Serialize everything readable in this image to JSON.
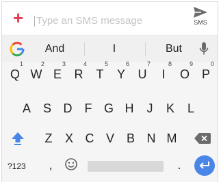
{
  "compose": {
    "plus_symbol": "+",
    "placeholder": "Type an SMS message",
    "send_label": "SMS"
  },
  "suggestions": {
    "icon": "google-g-icon",
    "items": [
      "And",
      "I",
      "But"
    ],
    "mic_icon": "mic-icon"
  },
  "keyboard": {
    "row1": [
      {
        "label": "Q",
        "hint": "1"
      },
      {
        "label": "W",
        "hint": "2"
      },
      {
        "label": "E",
        "hint": "3"
      },
      {
        "label": "R",
        "hint": "4"
      },
      {
        "label": "T",
        "hint": "5"
      },
      {
        "label": "Y",
        "hint": "6"
      },
      {
        "label": "U",
        "hint": "7"
      },
      {
        "label": "I",
        "hint": "8"
      },
      {
        "label": "O",
        "hint": "9"
      },
      {
        "label": "P",
        "hint": "0"
      }
    ],
    "row2": [
      "A",
      "S",
      "D",
      "F",
      "G",
      "H",
      "J",
      "K",
      "L"
    ],
    "row3": [
      "Z",
      "X",
      "C",
      "V",
      "B",
      "N",
      "M"
    ],
    "bottom": {
      "symbols_label": "?123",
      "comma": ",",
      "period": "."
    }
  },
  "colors": {
    "accent": "#e53950",
    "shift": "#4a86e8",
    "enter": "#4a86e8"
  }
}
